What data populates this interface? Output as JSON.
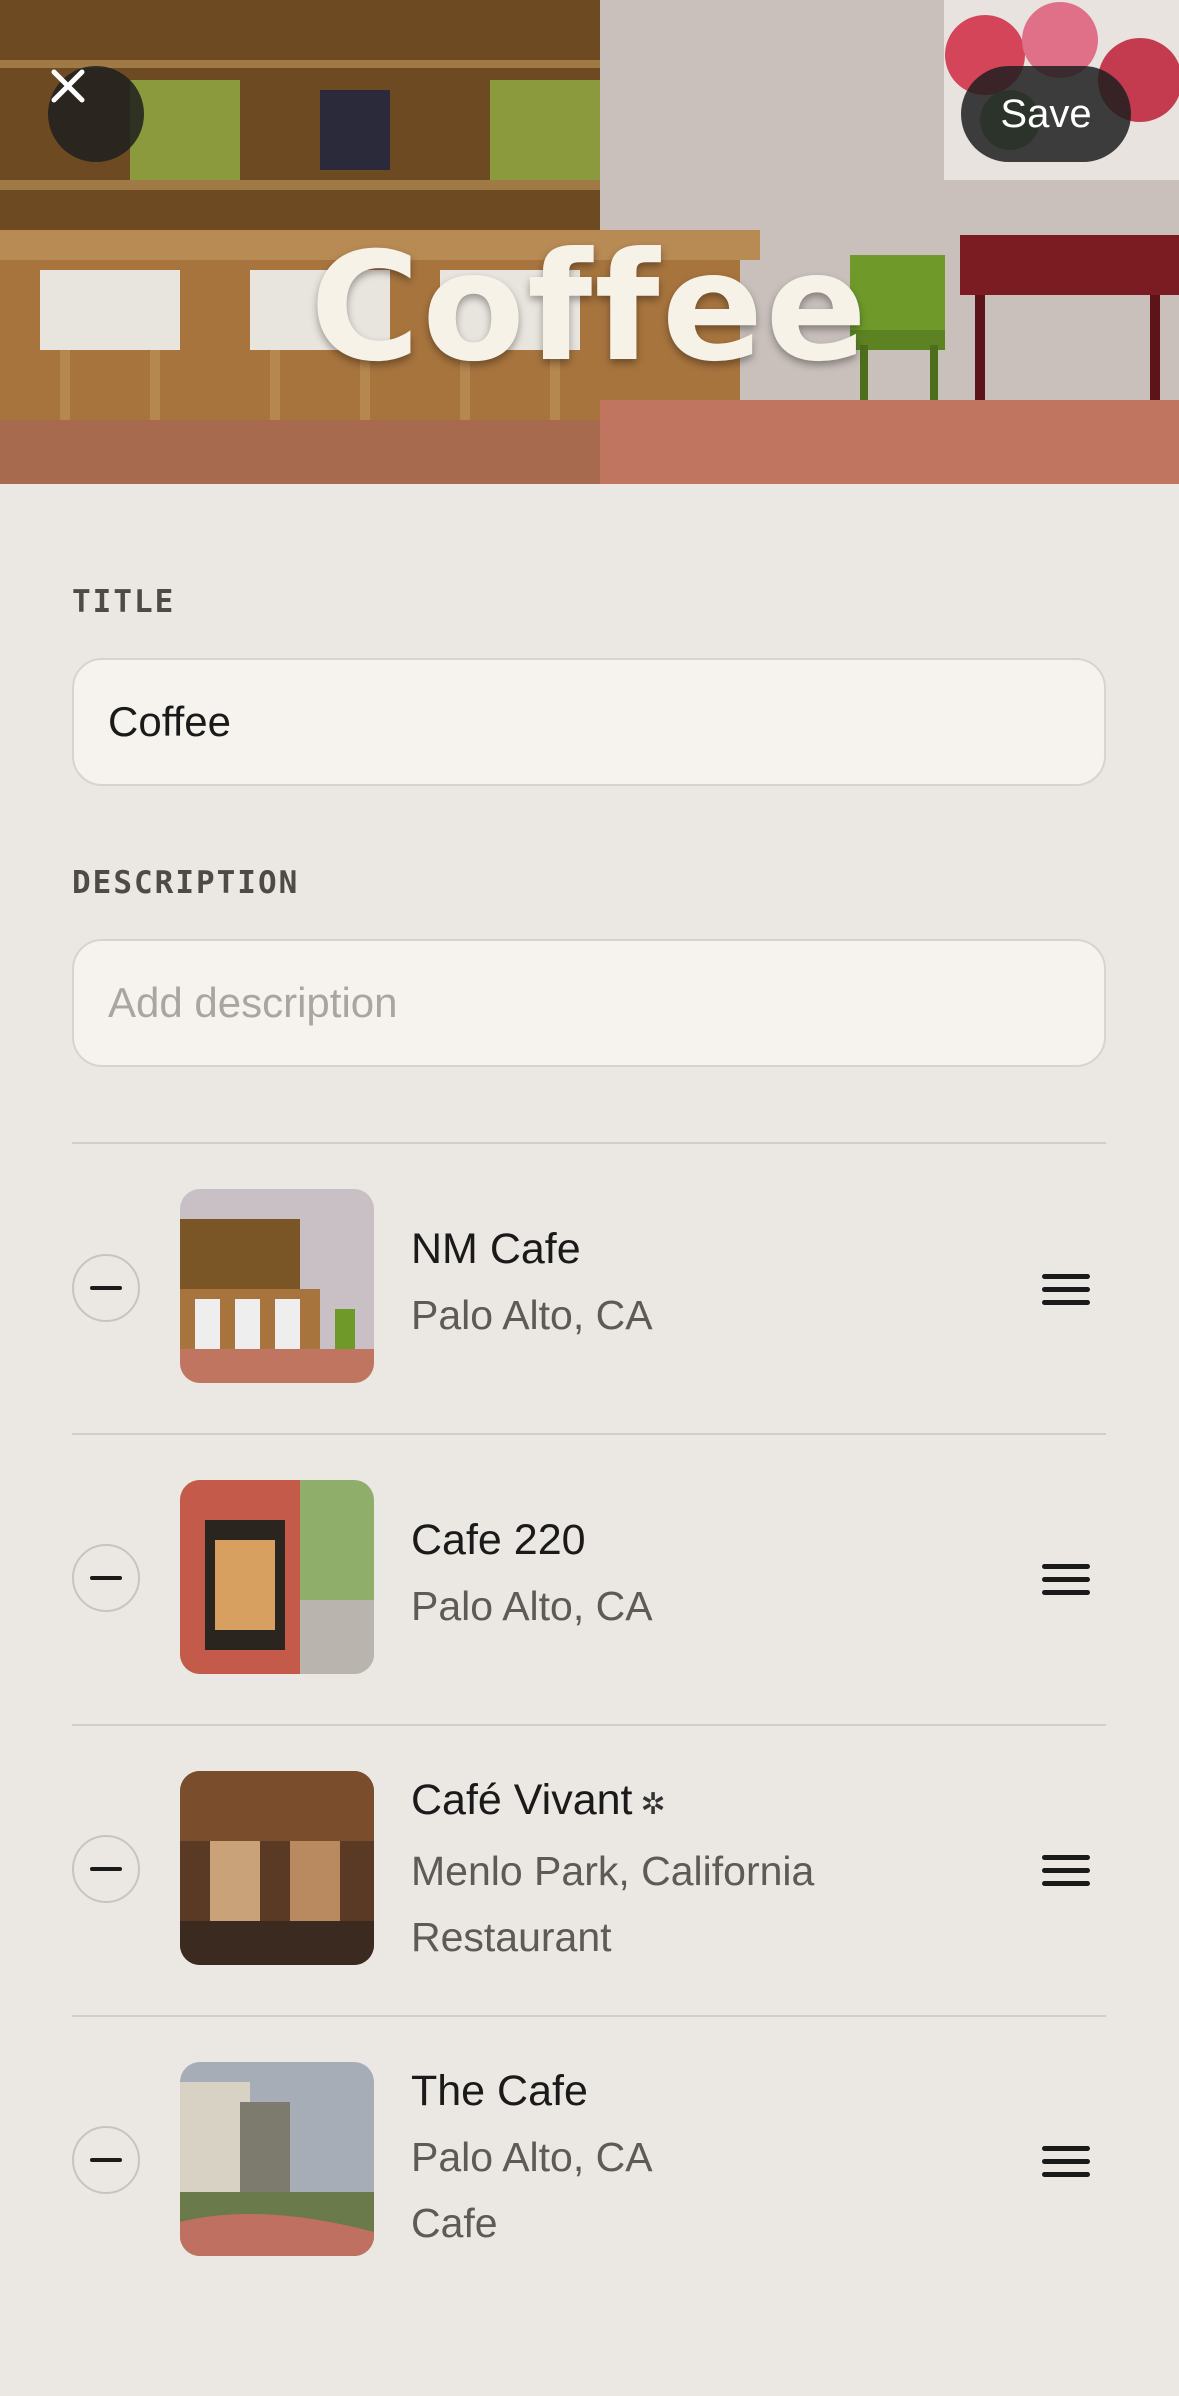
{
  "header": {
    "title": "Coffee",
    "save_label": "Save",
    "close_icon": "close-icon"
  },
  "form": {
    "title_label": "TITLE",
    "title_value": "Coffee",
    "description_label": "DESCRIPTION",
    "description_placeholder": "Add description"
  },
  "places": [
    {
      "name": "NM Cafe",
      "location": "Palo Alto, CA",
      "category": ""
    },
    {
      "name": "Cafe 220",
      "location": "Palo Alto, CA",
      "category": ""
    },
    {
      "name": "Café Vivant",
      "location": "Menlo Park, California",
      "category": "Restaurant",
      "badge_icon": "sparkle-icon"
    },
    {
      "name": "The Cafe",
      "location": "Palo Alto, CA",
      "category": "Cafe"
    }
  ],
  "colors": {
    "background": "#ebe7e2",
    "input_background": "#f6f3ee",
    "button_dark": "#1e1e1e"
  }
}
